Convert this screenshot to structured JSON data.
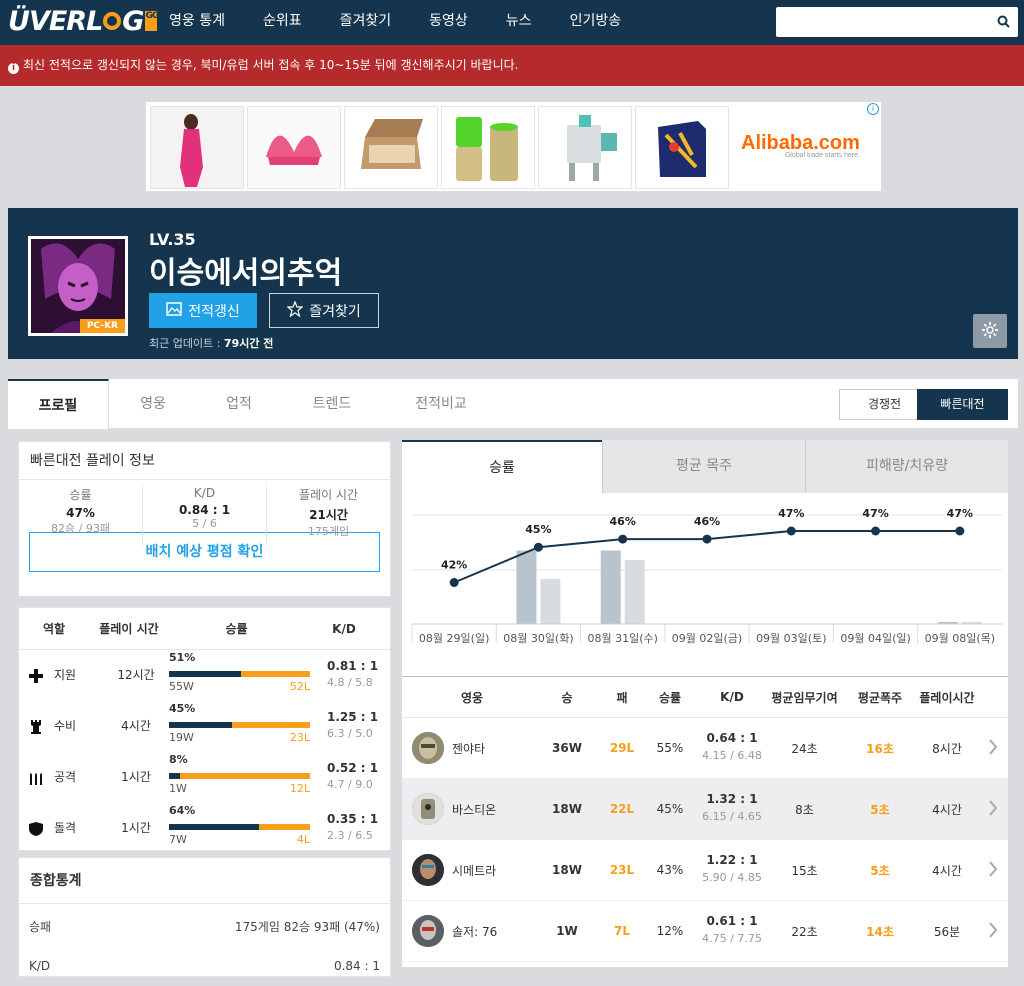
{
  "header": {
    "logo_text": "ÜVERLOG",
    "logo_badge": "GG",
    "nav": [
      "영웅 통계",
      "순위표",
      "즐겨찾기",
      "동영상",
      "뉴스",
      "인기방송"
    ],
    "search_placeholder": ""
  },
  "alert": {
    "icon": "info-icon",
    "text": "최신 전적으로 갱신되지 않는 경우, 북미/유럽 서버 접속 후 10~15분 뒤에 갱신해주시기 바랍니다."
  },
  "ad": {
    "brand": "Alibaba.com",
    "brand_sub": "Global trade starts here."
  },
  "profile": {
    "level": "LV.35",
    "name": "이승에서의추억",
    "platform": "PC-KR",
    "update_btn": "전적갱신",
    "fav_btn": "즐겨찾기",
    "updated_label": "최근 업데이트 : ",
    "updated_value": "79시간 전"
  },
  "tabs": [
    "프로필",
    "영웅",
    "업적",
    "트렌드",
    "전적비교"
  ],
  "modes": [
    "경쟁전",
    "빠른대전"
  ],
  "play_info": {
    "title": "빠른대전 플레이 정보",
    "stats": [
      {
        "label": "승률",
        "value": "47%",
        "sub": "82승 / 93패"
      },
      {
        "label": "K/D",
        "value": "0.84 : 1",
        "sub": "5 / 6"
      },
      {
        "label": "플레이 시간",
        "value": "21시간",
        "sub": "175게임"
      }
    ],
    "placement_btn": "배치 예상 평점 확인"
  },
  "roles": {
    "headers": [
      "역할",
      "플레이 시간",
      "승률",
      "K/D"
    ],
    "rows": [
      {
        "icon": "support-cross-icon",
        "name": "지원",
        "time": "12시간",
        "winrate": "51%",
        "win_fraction": 0.51,
        "wins": "55W",
        "losses": "52L",
        "kd": "0.81 : 1",
        "kd_sub": "4.8 / 5.8"
      },
      {
        "icon": "defense-tower-icon",
        "name": "수비",
        "time": "4시간",
        "winrate": "45%",
        "win_fraction": 0.45,
        "wins": "19W",
        "losses": "23L",
        "kd": "1.25 : 1",
        "kd_sub": "6.3 / 5.0"
      },
      {
        "icon": "offense-bullets-icon",
        "name": "공격",
        "time": "1시간",
        "winrate": "8%",
        "win_fraction": 0.08,
        "wins": "1W",
        "losses": "12L",
        "kd": "0.52 : 1",
        "kd_sub": "4.7 / 9.0"
      },
      {
        "icon": "tank-shield-icon",
        "name": "돌격",
        "time": "1시간",
        "winrate": "64%",
        "win_fraction": 0.64,
        "wins": "7W",
        "losses": "4L",
        "kd": "0.35 : 1",
        "kd_sub": "2.3 / 6.5"
      }
    ]
  },
  "overall": {
    "title": "종합통계",
    "rows": [
      {
        "label": "승패",
        "value": "175게임 82승 93패 (47%)"
      },
      {
        "label": "K/D",
        "value": "0.84 : 1"
      }
    ]
  },
  "chart_tabs": [
    "승률",
    "평균 목주",
    "피해량/치유량"
  ],
  "chart_data": {
    "type": "line",
    "categories": [
      "08월 29일(일)",
      "08월 30일(화)",
      "08월 31일(수)",
      "09월 02일(금)",
      "09월 03일(토)",
      "09월 04일(일)",
      "09월 08일(목)"
    ],
    "series": [
      {
        "values": [
          42,
          45,
          46,
          46,
          47,
          47,
          47
        ]
      }
    ],
    "data_labels": [
      "42%",
      "45%",
      "46%",
      "46%",
      "47%",
      "47%",
      "47%"
    ],
    "bars": {
      "wins": [
        0,
        7,
        7,
        0,
        0,
        0,
        0.2
      ],
      "losses": [
        0,
        4.3,
        6.1,
        0,
        0,
        0,
        0.2
      ]
    },
    "colors": {
      "line": "#15354f",
      "win_bar": "#b9c3cd",
      "loss_bar": "#d8dcdf"
    }
  },
  "heroes": {
    "headers": [
      "영웅",
      "승",
      "패",
      "승률",
      "K/D",
      "평균임무기여",
      "평균폭주",
      "플레이시간"
    ],
    "rows": [
      {
        "name": "젠야타",
        "win": "36W",
        "loss": "29L",
        "winrate": "55%",
        "kd": "0.64 : 1",
        "kd_sub": "4.15 / 6.48",
        "obj": "24초",
        "fire": "16초",
        "time": "8시간"
      },
      {
        "name": "바스티온",
        "win": "18W",
        "loss": "22L",
        "winrate": "45%",
        "kd": "1.32 : 1",
        "kd_sub": "6.15 / 4.65",
        "obj": "8초",
        "fire": "5초",
        "time": "4시간"
      },
      {
        "name": "시메트라",
        "win": "18W",
        "loss": "23L",
        "winrate": "43%",
        "kd": "1.22 : 1",
        "kd_sub": "5.90 / 4.85",
        "obj": "15초",
        "fire": "5초",
        "time": "4시간"
      },
      {
        "name": "솔저: 76",
        "win": "1W",
        "loss": "7L",
        "winrate": "12%",
        "kd": "0.61 : 1",
        "kd_sub": "4.75 / 7.75",
        "obj": "22초",
        "fire": "14초",
        "time": "56분"
      }
    ]
  }
}
